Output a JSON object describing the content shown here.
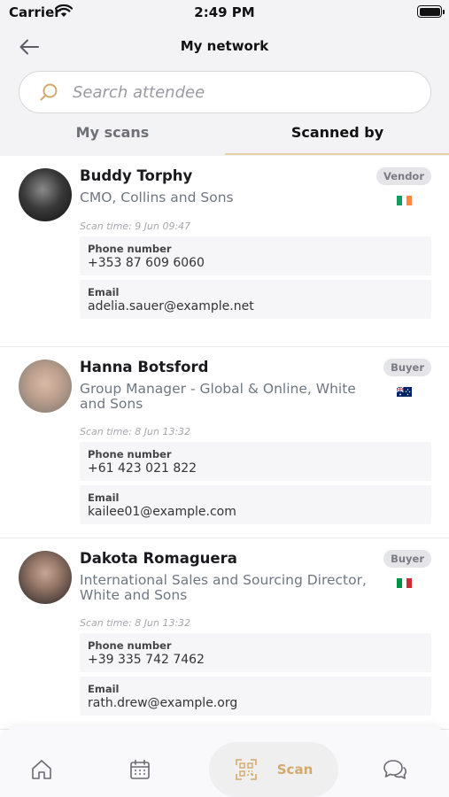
{
  "status": {
    "carrier": "Carrier",
    "time": "2:49 PM"
  },
  "header": {
    "title": "My network"
  },
  "search": {
    "placeholder": "Search attendee"
  },
  "tabs": [
    {
      "label": "My scans",
      "active": false
    },
    {
      "label": "Scanned by",
      "active": true
    }
  ],
  "contacts": [
    {
      "name": "Buddy Torphy",
      "role": "CMO, Collins and Sons",
      "badge": "Vendor",
      "flag": "Ireland",
      "scan_time": "Scan time: 9 Jun 09:47",
      "phone_label": "Phone number",
      "phone": "+353 87 609 6060",
      "email_label": "Email",
      "email": "adelia.sauer@example.net"
    },
    {
      "name": "Hanna Botsford",
      "role": "Group Manager - Global & Online, White and Sons",
      "badge": "Buyer",
      "flag": "Australia",
      "scan_time": "Scan time: 8 Jun 13:32",
      "phone_label": "Phone number",
      "phone": "+61 423 021 822",
      "email_label": "Email",
      "email": "kailee01@example.com"
    },
    {
      "name": "Dakota Romaguera",
      "role": "International Sales and Sourcing Director, White and Sons",
      "badge": "Buyer",
      "flag": "Italy",
      "scan_time": "Scan time: 8 Jun 13:32",
      "phone_label": "Phone number",
      "phone": "+39 335 742 7462",
      "email_label": "Email",
      "email": "rath.drew@example.org"
    }
  ],
  "bottom_nav": {
    "items": [
      "home-icon",
      "calendar-icon",
      "qr-scan-icon",
      "chat-icon"
    ],
    "scan_label": "Scan"
  },
  "colors": {
    "accent": "#d4a96a",
    "tab_underline": "#e6cfa4",
    "header_bg": "#f3f3f5"
  }
}
